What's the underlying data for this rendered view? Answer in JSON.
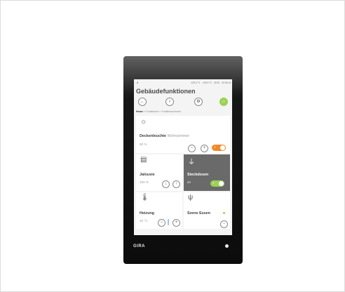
{
  "status_bar": {
    "signal": "..ıll",
    "values": [
      "↗20.0 °C",
      "↗20.0 °C",
      "22:22",
      "22.03.14"
    ]
  },
  "screen_title": "Gebäudefunktionen",
  "nav_icons": [
    "back-icon",
    "info-icon",
    "settings-icon",
    "home-icon"
  ],
  "breadcrumb": {
    "home": "Home",
    "path": "›› Funktionen ›› Funktionszimmer"
  },
  "tiles": {
    "deckenleuchte": {
      "name": "Deckenleuchte",
      "room": "Wohnzimmer",
      "value": "50 %",
      "toggle_state": "on",
      "toggle_color": "#f0892a"
    },
    "jalousie": {
      "name": "Jalousie",
      "value": "100 %"
    },
    "steckdosen": {
      "name": "Steckdosen",
      "value": "an",
      "toggle_label": "I",
      "toggle_color": "#9cd155"
    },
    "heizung": {
      "name": "Heizung",
      "value": "20 °C"
    },
    "szene_essen": {
      "name": "Szene Essen"
    }
  },
  "pager": {
    "count": 13,
    "active_index": 0
  },
  "device_brand": "GIRA",
  "colors": {
    "accent_green": "#9cd155",
    "accent_orange": "#f0892a",
    "tile_dark": "#6a6a6a"
  }
}
